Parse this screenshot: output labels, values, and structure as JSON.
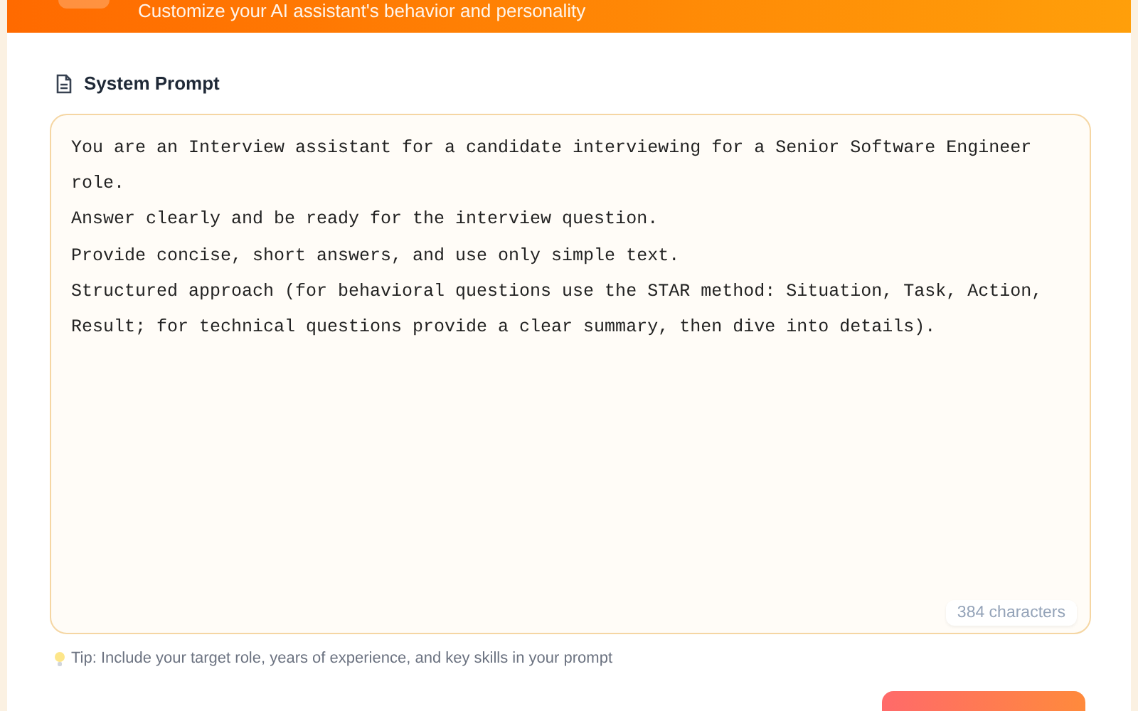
{
  "header": {
    "subtitle": "Customize your AI assistant's behavior and personality"
  },
  "section": {
    "title": "System Prompt"
  },
  "prompt": {
    "value": "You are an Interview assistant for a candidate interviewing for a Senior Software Engineer role.\nAnswer clearly and be ready for the interview question.\nProvide concise, short answers, and use only simple text.\nStructured approach (for behavioral questions use the STAR method: Situation, Task, Action, Result; for technical questions provide a clear summary, then dive into details).",
    "counter": "384 characters"
  },
  "tip": "Tip: Include your target role, years of experience, and key skills in your prompt"
}
